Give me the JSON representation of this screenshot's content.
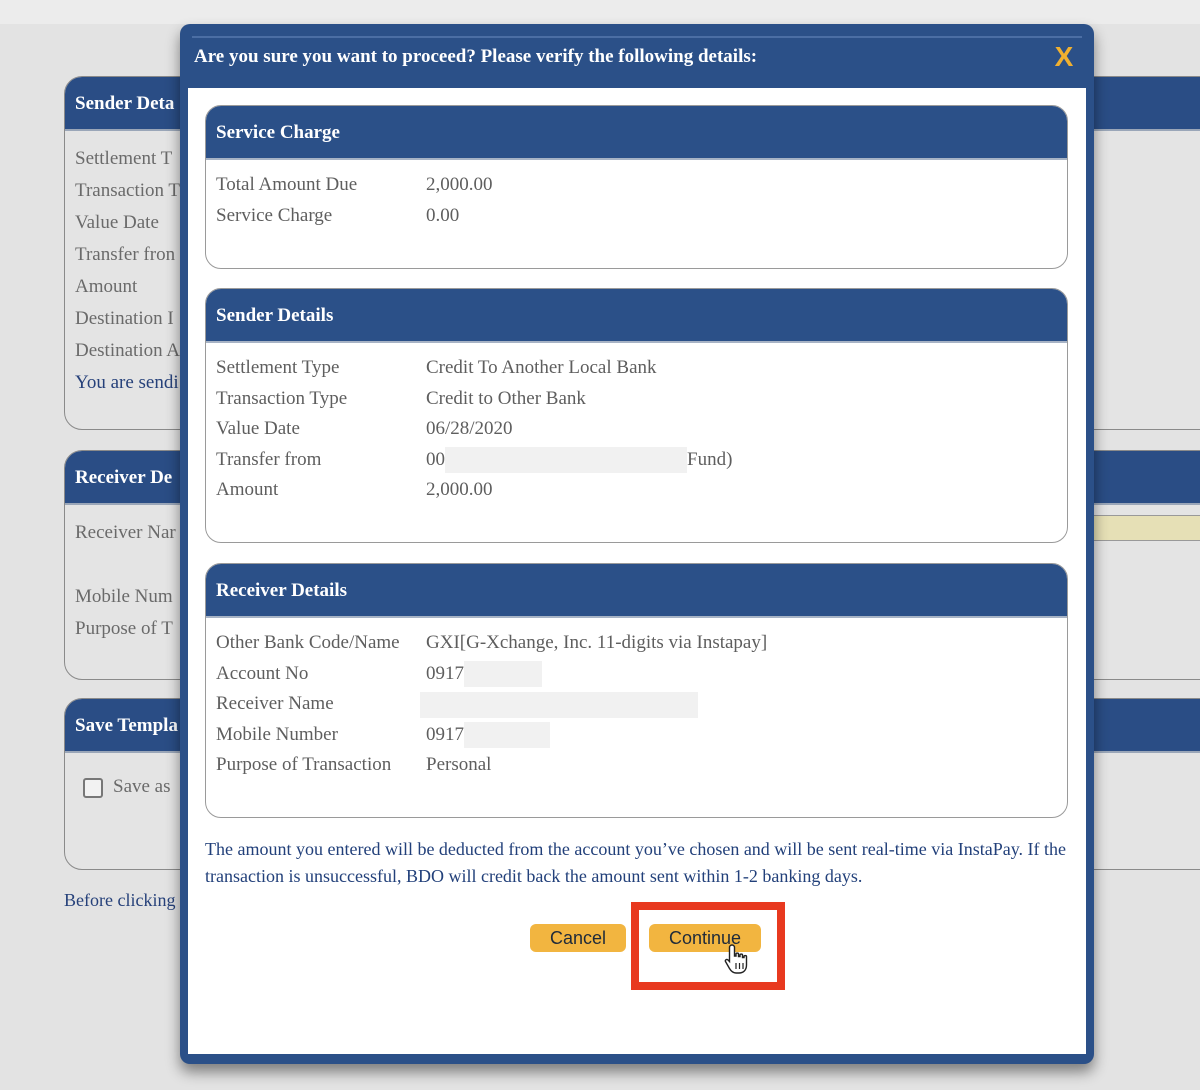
{
  "background": {
    "sender_panel": {
      "title": "Sender Deta",
      "rows": [
        "Settlement T",
        "Transaction T",
        "Value Date",
        "Transfer fron",
        "Amount",
        "Destination I",
        "Destination A"
      ],
      "note": "You are sendi"
    },
    "receiver_panel": {
      "title": "Receiver De",
      "rows": [
        "Receiver Nar",
        "",
        "Mobile Num",
        "Purpose of T"
      ]
    },
    "template_panel": {
      "title": "Save Templa",
      "checkbox_label": "Save as"
    },
    "before_text": "Before clicking"
  },
  "modal": {
    "title": "Are you sure you want to proceed? Please verify the following details:",
    "close_icon": "X",
    "sections": {
      "service_charge": {
        "title": "Service Charge",
        "rows": [
          {
            "label": "Total Amount Due",
            "value": "2,000.00"
          },
          {
            "label": "Service Charge",
            "value": "0.00"
          }
        ]
      },
      "sender_details": {
        "title": "Sender Details",
        "rows": [
          {
            "label": "Settlement Type",
            "value": "Credit To Another Local Bank"
          },
          {
            "label": "Transaction Type",
            "value": "Credit to Other Bank"
          },
          {
            "label": "Value Date",
            "value": "06/28/2020"
          },
          {
            "label": "Transfer from",
            "value_prefix": "00",
            "value_suffix": "Fund)"
          },
          {
            "label": "Amount",
            "value": "2,000.00"
          }
        ]
      },
      "receiver_details": {
        "title": "Receiver Details",
        "rows": [
          {
            "label": "Other Bank Code/Name",
            "value": "GXI[G-Xchange, Inc. 11-digits via Instapay]"
          },
          {
            "label": "Account No",
            "value": "0917"
          },
          {
            "label": "Receiver Name",
            "value": ""
          },
          {
            "label": "Mobile Number",
            "value": "0917"
          },
          {
            "label": "Purpose of Transaction",
            "value": "Personal"
          }
        ]
      }
    },
    "note": "The amount you entered will be deducted from the account you’ve chosen and will be sent real-time via InstaPay. If the transaction is unsuccessful, BDO will credit back the amount sent within 1-2 banking days.",
    "buttons": {
      "cancel": "Cancel",
      "continue": "Continue"
    }
  },
  "colors": {
    "brand_blue": "#2b5088",
    "button_yellow": "#f2b540",
    "highlight_red": "#e8391f",
    "close_orange": "#f0b030"
  }
}
